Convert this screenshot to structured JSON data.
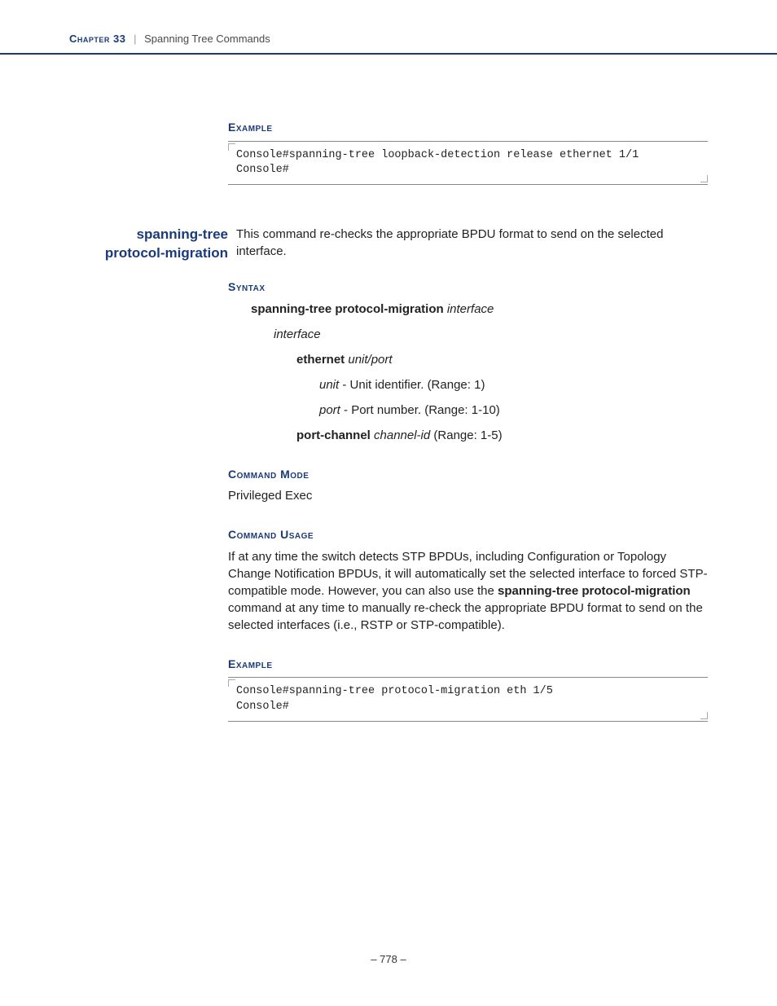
{
  "header": {
    "chapter": "Chapter 33",
    "separator": "|",
    "title": "Spanning Tree Commands"
  },
  "section1": {
    "heading": "Example",
    "code": "Console#spanning-tree loopback-detection release ethernet 1/1\nConsole#"
  },
  "command": {
    "name_line1": "spanning-tree",
    "name_line2": "protocol-migration",
    "description": "This command re-checks the appropriate BPDU format to send on the selected interface."
  },
  "syntax": {
    "heading": "Syntax",
    "line_cmd_bold": "spanning-tree protocol-migration",
    "line_cmd_arg": "interface",
    "interface_label": "interface",
    "ethernet_bold": "ethernet",
    "ethernet_args": "unit/port",
    "unit_label": "unit",
    "unit_desc": " - Unit identifier. (Range: 1)",
    "port_label": "port",
    "port_desc": " - Port number. (Range: 1-10)",
    "portchannel_bold": "port-channel",
    "portchannel_arg": "channel-id",
    "portchannel_desc": " (Range: 1-5)"
  },
  "mode": {
    "heading": "Command Mode",
    "text": "Privileged Exec"
  },
  "usage": {
    "heading": "Command Usage",
    "text_pre": "If at any time the switch detects STP BPDUs, including Configuration or Topology Change Notification BPDUs, it will automatically set the selected interface to forced STP-compatible mode. However, you can also use the ",
    "text_bold": "spanning-tree protocol-migration",
    "text_post": " command at any time to manually re-check the appropriate BPDU format to send on the selected interfaces (i.e., RSTP or STP-compatible)."
  },
  "section2": {
    "heading": "Example",
    "code": "Console#spanning-tree protocol-migration eth 1/5\nConsole#"
  },
  "footer": {
    "page": "– 778 –"
  }
}
